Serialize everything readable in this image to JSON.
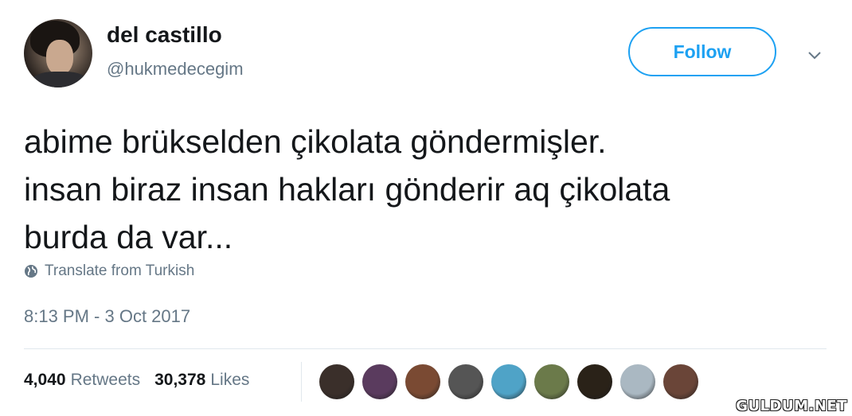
{
  "author": {
    "name": "del castillo",
    "handle": "@hukmedecegim"
  },
  "actions": {
    "follow_label": "Follow",
    "menu_icon": "chevron-down-icon"
  },
  "tweet": {
    "text": "abime brükselden çikolata göndermişler.\ninsan biraz insan hakları gönderir aq çikolata\nburda da var...",
    "translate_label": "Translate from Turkish",
    "translate_icon": "globe-icon",
    "timestamp": "8:13 PM - 3 Oct 2017"
  },
  "stats": {
    "retweets_count": "4,040",
    "retweets_label": "Retweets",
    "likes_count": "30,378",
    "likes_label": "Likes"
  },
  "likers": [
    {
      "avatar": "liker-avatar-1",
      "color": "#3a2f2a"
    },
    {
      "avatar": "liker-avatar-2",
      "color": "#5a3b5e"
    },
    {
      "avatar": "liker-avatar-3",
      "color": "#7a4a33"
    },
    {
      "avatar": "liker-avatar-4",
      "color": "#555555"
    },
    {
      "avatar": "liker-avatar-5",
      "color": "#4fa3c7"
    },
    {
      "avatar": "liker-avatar-6",
      "color": "#6b7a4a"
    },
    {
      "avatar": "liker-avatar-7",
      "color": "#2a2218"
    },
    {
      "avatar": "liker-avatar-8",
      "color": "#aab8c2"
    },
    {
      "avatar": "liker-avatar-9",
      "color": "#6a4538"
    }
  ],
  "watermark": "GULDUM.NET",
  "colors": {
    "accent": "#1da1f2",
    "secondary_text": "#657786",
    "primary_text": "#14171a",
    "divider": "#e1e8ed"
  }
}
